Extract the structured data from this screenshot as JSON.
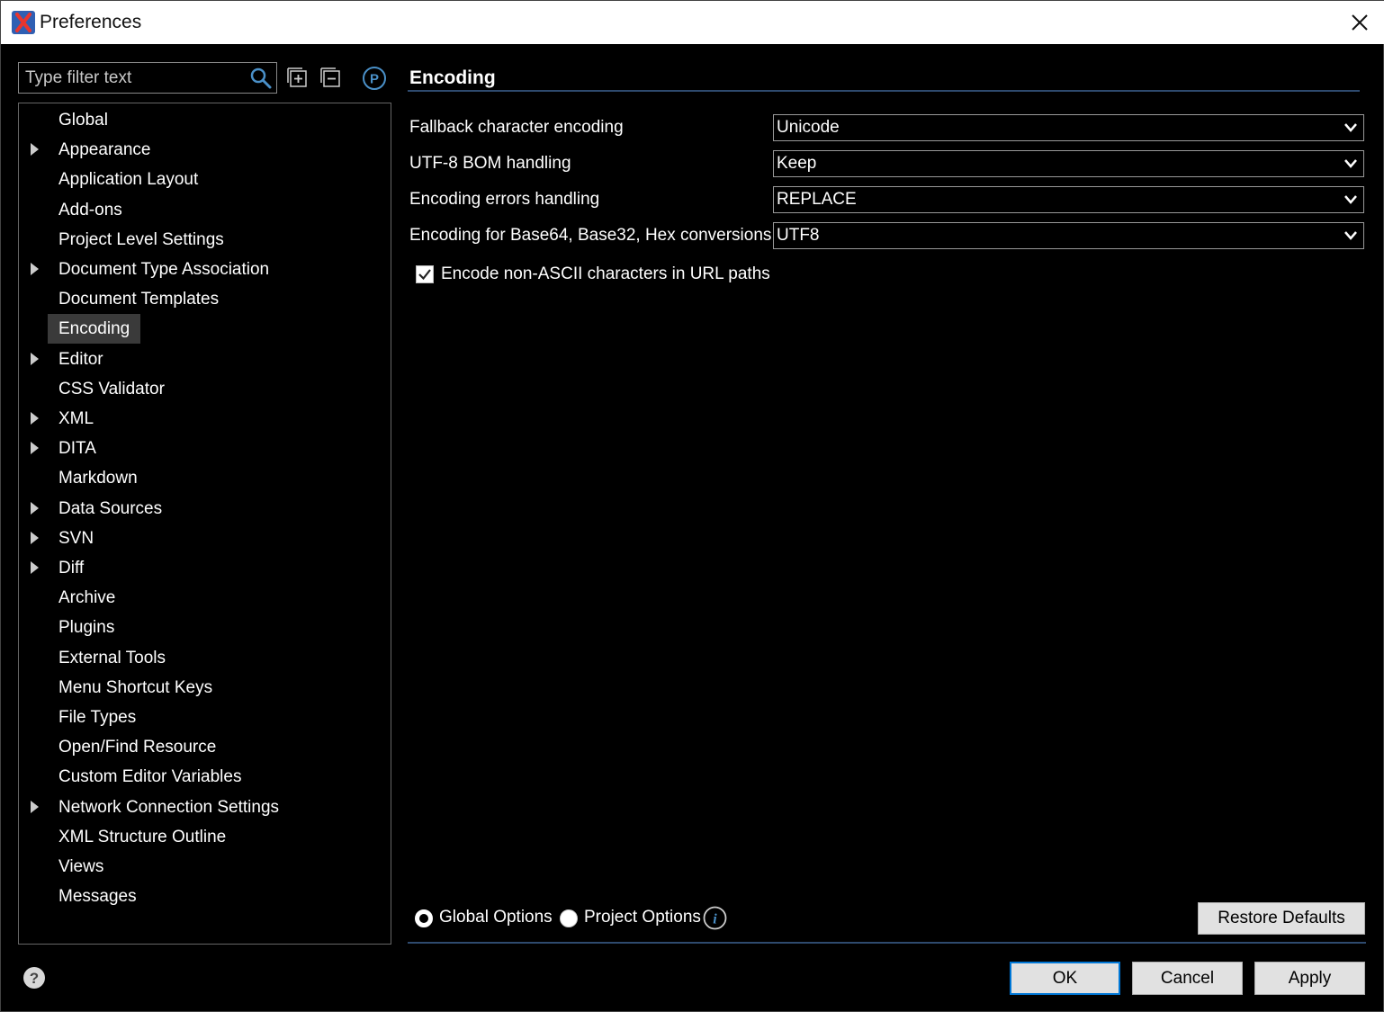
{
  "window": {
    "title": "Preferences"
  },
  "filter": {
    "placeholder": "Type filter text"
  },
  "tree": {
    "items": [
      {
        "label": "Global",
        "expandable": false
      },
      {
        "label": "Appearance",
        "expandable": true
      },
      {
        "label": "Application Layout",
        "expandable": false
      },
      {
        "label": "Add-ons",
        "expandable": false
      },
      {
        "label": "Project Level Settings",
        "expandable": false
      },
      {
        "label": "Document Type Association",
        "expandable": true
      },
      {
        "label": "Document Templates",
        "expandable": false
      },
      {
        "label": "Encoding",
        "expandable": false,
        "selected": true
      },
      {
        "label": "Editor",
        "expandable": true
      },
      {
        "label": "CSS Validator",
        "expandable": false
      },
      {
        "label": "XML",
        "expandable": true
      },
      {
        "label": "DITA",
        "expandable": true
      },
      {
        "label": "Markdown",
        "expandable": false
      },
      {
        "label": "Data Sources",
        "expandable": true
      },
      {
        "label": "SVN",
        "expandable": true
      },
      {
        "label": "Diff",
        "expandable": true
      },
      {
        "label": "Archive",
        "expandable": false
      },
      {
        "label": "Plugins",
        "expandable": false
      },
      {
        "label": "External Tools",
        "expandable": false
      },
      {
        "label": "Menu Shortcut Keys",
        "expandable": false
      },
      {
        "label": "File Types",
        "expandable": false
      },
      {
        "label": "Open/Find Resource",
        "expandable": false
      },
      {
        "label": "Custom Editor Variables",
        "expandable": false
      },
      {
        "label": "Network Connection Settings",
        "expandable": true
      },
      {
        "label": "XML Structure Outline",
        "expandable": false
      },
      {
        "label": "Views",
        "expandable": false
      },
      {
        "label": "Messages",
        "expandable": false
      }
    ]
  },
  "page": {
    "title": "Encoding",
    "fields": [
      {
        "label": "Fallback character encoding",
        "value": "Unicode"
      },
      {
        "label": "UTF-8 BOM handling",
        "value": "Keep"
      },
      {
        "label": "Encoding errors handling",
        "value": "REPLACE"
      },
      {
        "label": "Encoding for Base64, Base32, Hex conversions",
        "value": "UTF8"
      }
    ],
    "checkbox": {
      "label": "Encode non-ASCII characters in URL paths",
      "checked": true
    },
    "scope": {
      "global_label": "Global Options",
      "project_label": "Project Options",
      "selected": "global"
    },
    "restore_label": "Restore Defaults"
  },
  "footer": {
    "ok_label": "OK",
    "cancel_label": "Cancel",
    "apply_label": "Apply"
  },
  "colors": {
    "background": "#000000",
    "selection": "#3a3a3a",
    "rule": "#2e4a6e",
    "default_button_border": "#0078d7",
    "info_icon": "#4a90c8"
  },
  "icons": [
    "app-logo-icon",
    "close-icon",
    "search-icon",
    "expand-all-icon",
    "collapse-all-icon",
    "project-p-icon",
    "chevron-down-icon",
    "checkmark-icon",
    "info-icon",
    "help-icon"
  ]
}
